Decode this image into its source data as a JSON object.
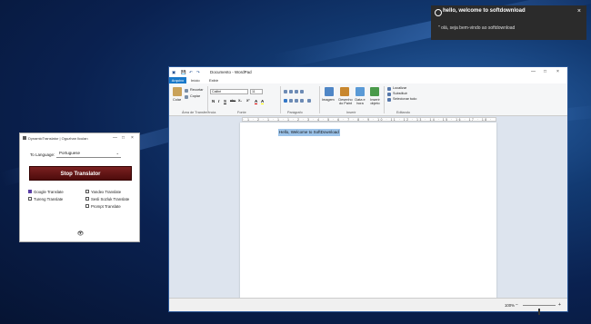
{
  "notification": {
    "title": "hello, welcome to softdownload",
    "close": "×",
    "message": "\" olá, seja bem-vindo ao softdownload"
  },
  "translator": {
    "title": "DynamicTranslator | Oguzhan Iiculan",
    "window_buttons": [
      "—",
      "□",
      "×"
    ],
    "to_language_label": "To Language:",
    "to_language_value": "Portuguese",
    "stop_label": "Stop Translator",
    "services_left": [
      {
        "label": "Google Translate",
        "checked": true
      },
      {
        "label": "Tureng Translate",
        "checked": false
      }
    ],
    "services_right": [
      {
        "label": "Yandex Translate",
        "checked": false
      },
      {
        "label": "Sesli Sozluk Translate",
        "checked": false
      },
      {
        "label": "Prompt Translate",
        "checked": false
      }
    ],
    "eye_icon": "👁"
  },
  "wordpad": {
    "title": "Documento - WordPad",
    "window_buttons": [
      "—",
      "□",
      "×"
    ],
    "quick_access": [
      "💾",
      "↶",
      "↷"
    ],
    "menu": {
      "file": "Arquivo",
      "tabs": [
        "Início",
        "Exibir"
      ]
    },
    "ribbon": {
      "clipboard": {
        "paste": "Colar",
        "cut": "Recortar",
        "copy": "Copiar",
        "group": "Área de Transferência"
      },
      "font": {
        "family": "Calibri",
        "size": "11",
        "group": "Fonte",
        "format_buttons": [
          "N",
          "I",
          "S",
          "abc",
          "X₂",
          "X²",
          "A",
          "A"
        ]
      },
      "paragraph": {
        "group": "Parágrafo"
      },
      "insert": {
        "image": "Imagem",
        "paint": "Desenho do Paint",
        "datetime": "Data e hora",
        "object": "Inserir objeto",
        "group": "Inserir"
      },
      "editing": {
        "find": "Localizar",
        "replace": "Substituir",
        "select_all": "Selecionar tudo",
        "group": "Editando"
      }
    },
    "ruler": "· 1 · 2 · 1 · 1 · 1 · 2 · 3 · 4 · 5 · 6 · 7 · 8 · 9 · 10 · 11 · 12 · 13 · 14 · 15 · 16 · 17 · 18 ·",
    "document_text": "Hello, Welcome to SoftDownload",
    "zoom": "100%",
    "zoom_level": 0.5,
    "zoom_minus": "−",
    "zoom_plus": "+"
  }
}
